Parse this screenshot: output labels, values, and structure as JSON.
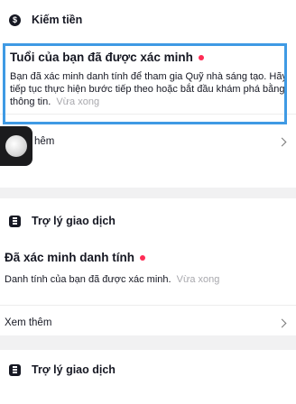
{
  "earn_section": {
    "icon": "dollar-icon",
    "icon_glyph": "$",
    "title": "Kiếm tiền"
  },
  "age_notification": {
    "title": "Tuổi của bạn đã được xác minh",
    "body": "Bạn đã xác minh danh tính để tham gia Quỹ nhà sáng tạo. Hãy tiếp tục thực hiện bước tiếp theo hoặc bắt đầu khám phá bằng thông tin.",
    "time": "Vừa xong"
  },
  "see_more_1": {
    "label": "hêm"
  },
  "assistant_section_1": {
    "icon": "document-icon",
    "title": "Trợ lý giao dịch"
  },
  "identity_notification": {
    "title": "Đã xác minh danh tính",
    "body": "Danh tính của bạn đã được xác minh.",
    "time": "Vừa xong"
  },
  "see_more_2": {
    "label": "Xem thêm"
  },
  "assistant_section_2": {
    "icon": "document-icon",
    "title": "Trợ lý giao dịch"
  },
  "colors": {
    "unread_dot": "#fe2c55",
    "highlight": "#3f9ae4",
    "background": "#f1f1f2"
  }
}
